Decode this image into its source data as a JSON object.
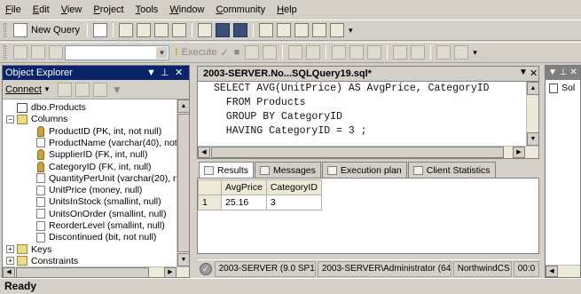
{
  "menu": {
    "items": [
      "File",
      "Edit",
      "View",
      "Project",
      "Tools",
      "Window",
      "Community",
      "Help"
    ],
    "underline": [
      "F",
      "E",
      "V",
      "P",
      "T",
      "W",
      "C",
      "H"
    ]
  },
  "toolbar": {
    "new_query_label": "New Query",
    "execute_label": "Execute"
  },
  "object_explorer": {
    "title": "Object Explorer",
    "connect_label": "Connect",
    "tree": [
      {
        "label": "dbo.Products",
        "type": "table",
        "indent": 0,
        "expander": "minus"
      },
      {
        "label": "Columns",
        "type": "folder",
        "indent": 1,
        "expander": "minus"
      },
      {
        "label": "ProductID (PK, int, not null)",
        "type": "key",
        "indent": 2
      },
      {
        "label": "ProductName (varchar(40), not",
        "type": "column",
        "indent": 2
      },
      {
        "label": "SupplierID (FK, int, null)",
        "type": "key",
        "indent": 2
      },
      {
        "label": "CategoryID (FK, int, null)",
        "type": "key",
        "indent": 2
      },
      {
        "label": "QuantityPerUnit (varchar(20), nu",
        "type": "column",
        "indent": 2
      },
      {
        "label": "UnitPrice (money, null)",
        "type": "column",
        "indent": 2
      },
      {
        "label": "UnitsInStock (smallint, null)",
        "type": "column",
        "indent": 2
      },
      {
        "label": "UnitsOnOrder (smallint, null)",
        "type": "column",
        "indent": 2
      },
      {
        "label": "ReorderLevel (smallint, null)",
        "type": "column",
        "indent": 2
      },
      {
        "label": "Discontinued (bit, not null)",
        "type": "column",
        "indent": 2
      },
      {
        "label": "Keys",
        "type": "folder",
        "indent": 1,
        "expander": "plus"
      },
      {
        "label": "Constraints",
        "type": "folder",
        "indent": 1,
        "expander": "plus"
      }
    ]
  },
  "editor": {
    "tab_title": "2003-SERVER.No...SQLQuery19.sql*",
    "lines": [
      "SELECT AVG(UnitPrice) AS AvgPrice, CategoryID",
      "  FROM Products",
      "  GROUP BY CategoryID",
      "  HAVING CategoryID = 3 ;"
    ]
  },
  "results": {
    "tabs": [
      "Results",
      "Messages",
      "Execution plan",
      "Client Statistics"
    ],
    "columns": [
      "AvgPrice",
      "CategoryID"
    ],
    "rows": [
      {
        "row_number": "1",
        "cells": [
          "25.16",
          "3"
        ]
      }
    ]
  },
  "exec_status": {
    "server": "2003-SERVER (9.0 SP1)",
    "user": "2003-SERVER\\Administrator (64)",
    "database": "NorthwindCS",
    "time": "00:0"
  },
  "right_panel": {
    "item": "Sol"
  },
  "status_bar": {
    "text": "Ready"
  }
}
